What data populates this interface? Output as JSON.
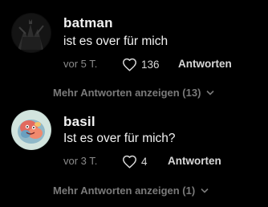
{
  "comments": [
    {
      "username": "batman",
      "text": "ist es over für mich",
      "time": "vor 5 T.",
      "likes": "136",
      "reply_label": "Antworten",
      "more_replies": "Mehr Antworten anzeigen (13)"
    },
    {
      "username": "basil",
      "text": "Ist es over für mich?",
      "time": "vor 3 T.",
      "likes": "4",
      "reply_label": "Antworten",
      "more_replies": "Mehr Antworten anzeigen (1)"
    }
  ],
  "icons": {
    "like": "heart-outline-icon",
    "expand": "chevron-down-icon"
  }
}
